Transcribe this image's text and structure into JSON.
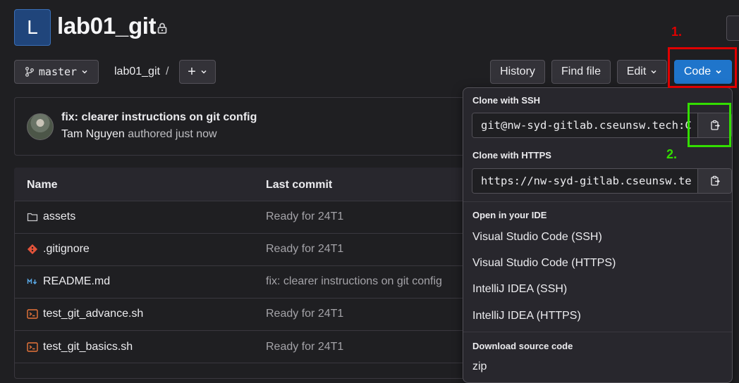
{
  "project": {
    "avatar_letter": "L",
    "title": "lab01_git"
  },
  "toolbar": {
    "branch": "master",
    "breadcrumb_root": "lab01_git",
    "breadcrumb_sep": "/",
    "plus_label": "+",
    "history": "History",
    "find_file": "Find file",
    "edit": "Edit",
    "code": "Code"
  },
  "annotations": {
    "step1": "1.",
    "step2": "2.",
    "step1_color": "#e00000",
    "step2_color": "#33dd00"
  },
  "commit": {
    "title": "fix: clearer instructions on git config",
    "author": "Tam Nguyen",
    "authored": "authored just now"
  },
  "table": {
    "headers": [
      "Name",
      "Last commit"
    ],
    "rows": [
      {
        "icon": "folder-icon",
        "name": "assets",
        "commit": "Ready for 24T1"
      },
      {
        "icon": "git-icon",
        "name": ".gitignore",
        "commit": "Ready for 24T1"
      },
      {
        "icon": "markdown-icon",
        "name": "README.md",
        "commit": "fix: clearer instructions on git config"
      },
      {
        "icon": "shell-icon",
        "name": "test_git_advance.sh",
        "commit": "Ready for 24T1"
      },
      {
        "icon": "shell-icon",
        "name": "test_git_basics.sh",
        "commit": "Ready for 24T1"
      }
    ]
  },
  "dropdown": {
    "ssh_heading": "Clone with SSH",
    "ssh_url": "git@nw-syd-gitlab.cseunsw.tech:C",
    "https_heading": "Clone with HTTPS",
    "https_url": "https://nw-syd-gitlab.cseunsw.te",
    "ide_heading": "Open in your IDE",
    "ide_items": [
      "Visual Studio Code (SSH)",
      "Visual Studio Code (HTTPS)",
      "IntelliJ IDEA (SSH)",
      "IntelliJ IDEA (HTTPS)"
    ],
    "download_heading": "Download source code",
    "download_first": "zip"
  },
  "colors": {
    "background": "#1f1f22",
    "accent": "#1f75cb"
  }
}
